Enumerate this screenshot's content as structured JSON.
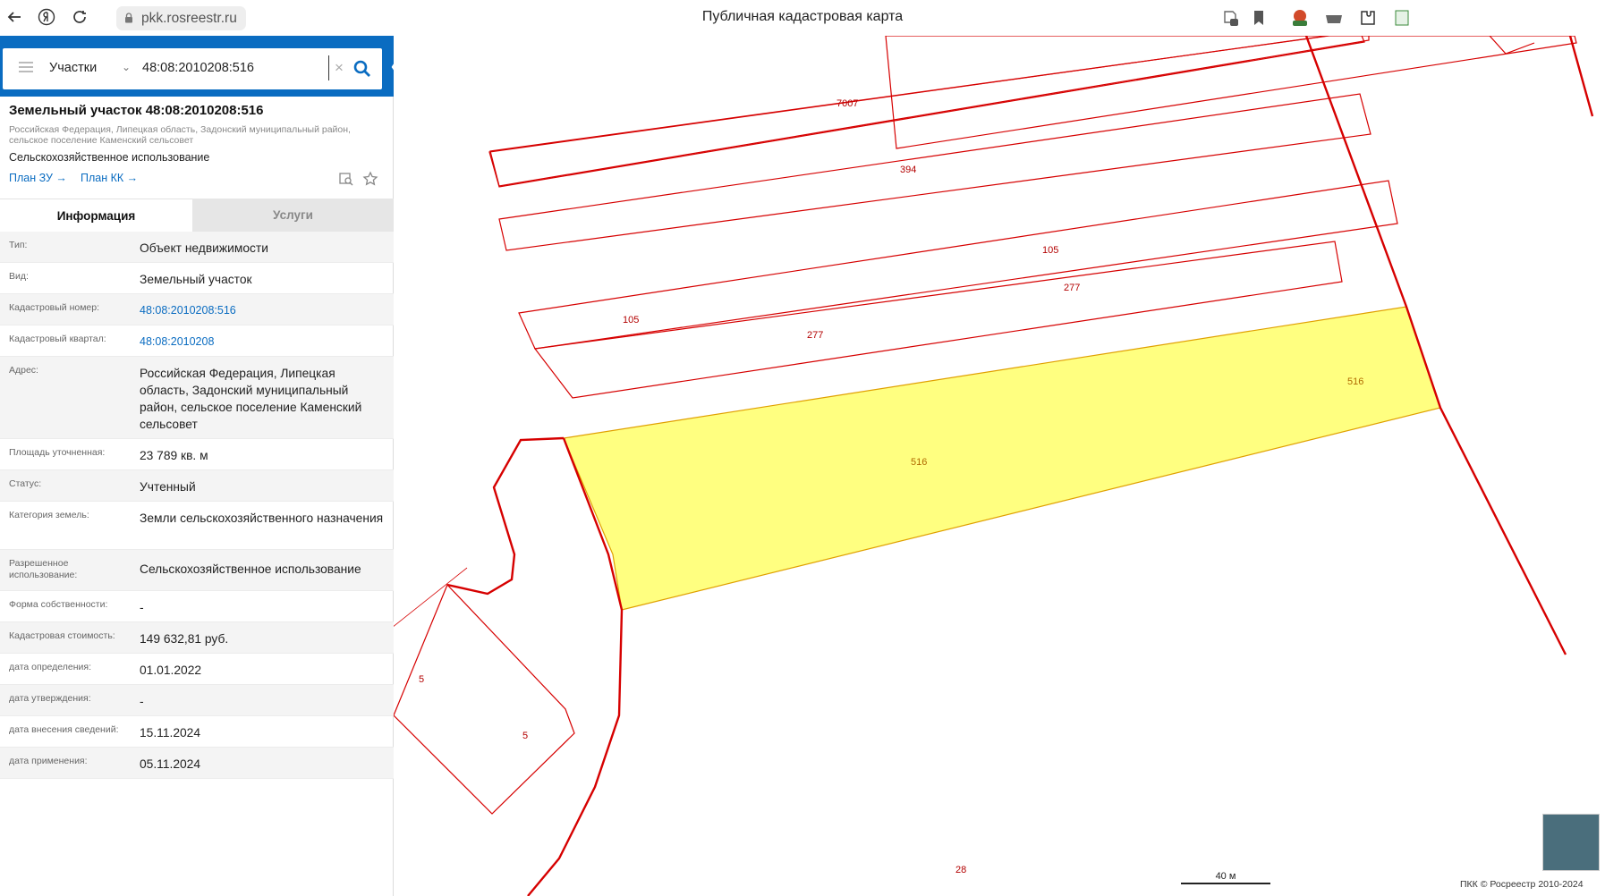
{
  "browser": {
    "url": "pkk.rosreestr.ru",
    "page_title": "Публичная кадастровая карта"
  },
  "search": {
    "type_label": "Участки",
    "query": "48:08:2010208:516"
  },
  "parcel": {
    "title": "Земельный участок 48:08:2010208:516",
    "address_line": "Российская Федерация, Липецкая область, Задонский муниципальный район, сельское поселение Каменский сельсовет",
    "usage": "Сельскохозяйственное использование",
    "link_plan_zu": "План ЗУ →",
    "link_plan_kk": "План КК →"
  },
  "tabs": {
    "info": "Информация",
    "services": "Услуги"
  },
  "info_rows": [
    {
      "label": "Тип:",
      "value": "Объект недвижимости"
    },
    {
      "label": "Вид:",
      "value": "Земельный участок"
    },
    {
      "label": "Кадастровый номер:",
      "value": "48:08:2010208:516"
    },
    {
      "label": "Кадастровый квартал:",
      "value": "48:08:2010208"
    },
    {
      "label": "Адрес:",
      "value": "Российская Федерация, Липецкая область, Задонский муниципальный район, сельское поселение Каменский сельсовет"
    },
    {
      "label": "Площадь уточненная:",
      "value": "23 789 кв. м"
    },
    {
      "label": "Статус:",
      "value": "Учтенный"
    },
    {
      "label": "Категория земель:",
      "value": "Земли сельскохозяйственного назначения"
    },
    {
      "label": "Разрешенное использование:",
      "value": "Сельскохозяйственное использование"
    },
    {
      "label": "Форма собственности:",
      "value": "-"
    },
    {
      "label": "Кадастровая стоимость:",
      "value": "149 632,81 руб."
    },
    {
      "label": "дата определения:",
      "value": "01.01.2022"
    },
    {
      "label": "дата утверждения:",
      "value": "-"
    },
    {
      "label": "дата внесения сведений:",
      "value": "15.11.2024"
    },
    {
      "label": "дата применения:",
      "value": "05.11.2024"
    }
  ],
  "map": {
    "labels": {
      "p7007": "7007",
      "p394": "394",
      "p105a": "105",
      "p105b": "105",
      "p277a": "277",
      "p277b": "277",
      "p516a": "516",
      "p516b": "516",
      "p5a": "5",
      "p5b": "5",
      "p28": "28"
    },
    "scale": "40 м",
    "copyright": "ПКК © Росреестр 2010-2024"
  },
  "colors": {
    "header_blue": "#0a6cc1",
    "parcel_outline": "#d60000",
    "selected_fill": "#ffff80",
    "selected_outline": "#e0a000"
  }
}
